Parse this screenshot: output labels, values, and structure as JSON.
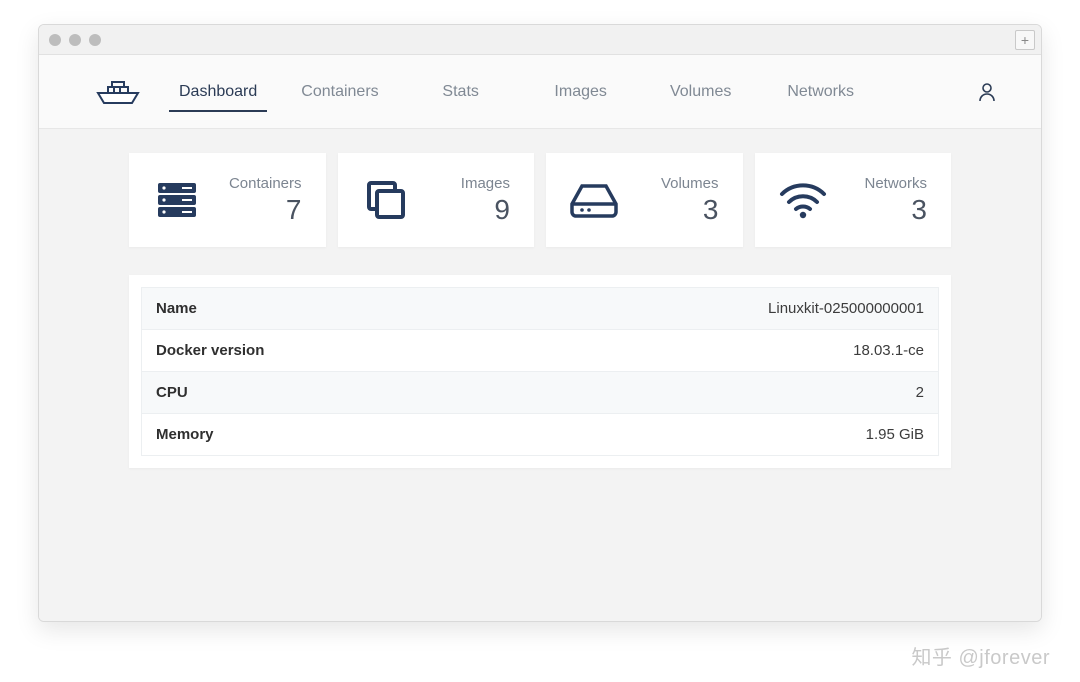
{
  "nav": {
    "items": [
      {
        "label": "Dashboard",
        "active": true
      },
      {
        "label": "Containers",
        "active": false
      },
      {
        "label": "Stats",
        "active": false
      },
      {
        "label": "Images",
        "active": false
      },
      {
        "label": "Volumes",
        "active": false
      },
      {
        "label": "Networks",
        "active": false
      }
    ]
  },
  "stats": {
    "containers": {
      "label": "Containers",
      "value": "7"
    },
    "images": {
      "label": "Images",
      "value": "9"
    },
    "volumes": {
      "label": "Volumes",
      "value": "3"
    },
    "networks": {
      "label": "Networks",
      "value": "3"
    }
  },
  "info": [
    {
      "key": "Name",
      "value": "Linuxkit-025000000001"
    },
    {
      "key": "Docker version",
      "value": "18.03.1-ce"
    },
    {
      "key": "CPU",
      "value": "2"
    },
    {
      "key": "Memory",
      "value": "1.95 GiB"
    }
  ],
  "watermark": "知乎 @jforever"
}
